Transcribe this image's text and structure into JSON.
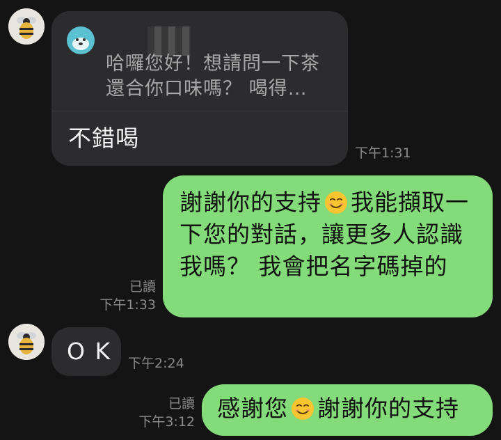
{
  "messages": {
    "m1": {
      "quoted_text": "哈囉您好！想請問一下茶還合你口味嗎？ 喝得…",
      "text": "不錯喝",
      "time": "下午1:31"
    },
    "m2": {
      "text_before_emoji": "謝謝你的支持",
      "text_after_emoji": "我能擷取一下您的對話，讓更多人認識我嗎？ 我會把名字碼掉的",
      "read": "已讀",
      "time": "下午1:33",
      "emoji": "smiling-face-emoji"
    },
    "m3": {
      "text": "O K",
      "time": "下午2:24"
    },
    "m4": {
      "text_before_emoji": "感謝您",
      "text_after_emoji": "謝謝你的支持",
      "read": "已讀",
      "time": "下午3:12",
      "emoji": "smiling-face-emoji"
    }
  },
  "colors": {
    "background": "#141414",
    "incoming_bubble": "#2c2c2e",
    "outgoing_bubble": "#84db7a",
    "timestamp": "#8b8b8b"
  }
}
